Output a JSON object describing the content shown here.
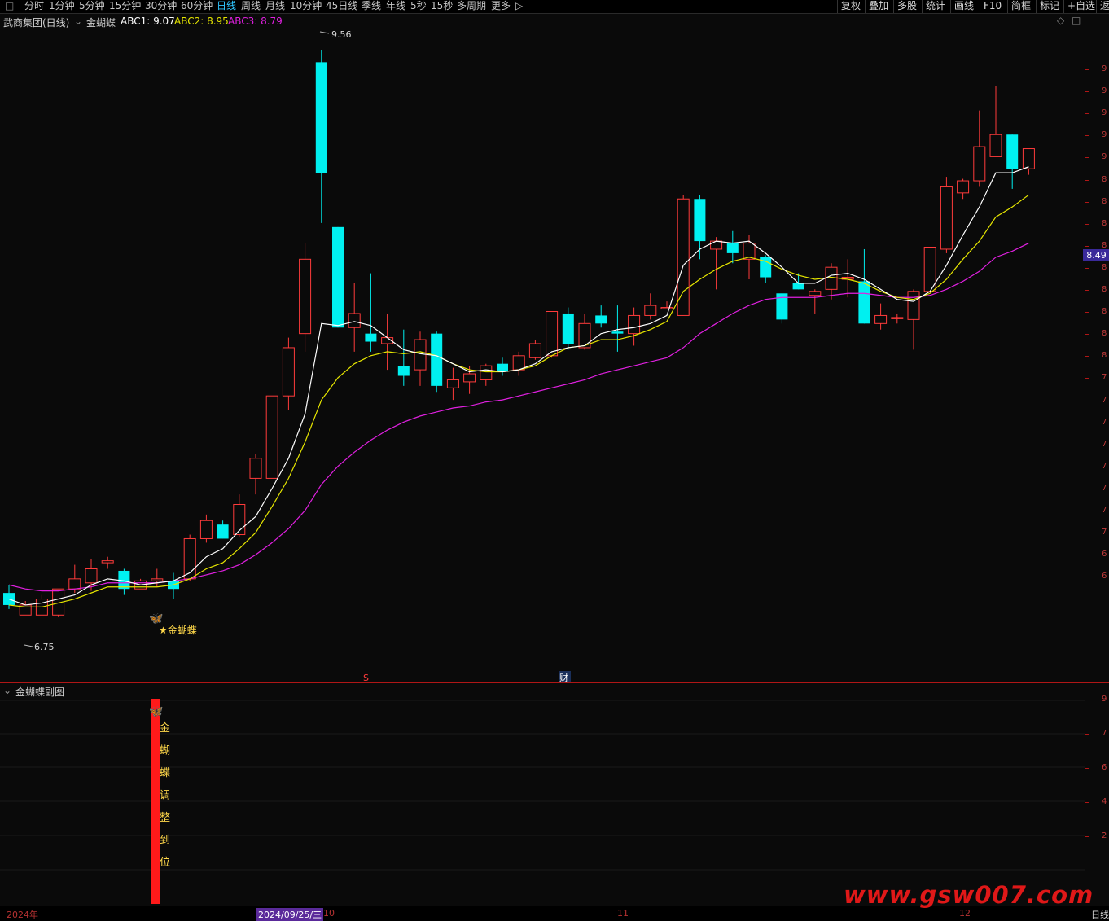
{
  "toolbar": {
    "periods": [
      "分时",
      "1分钟",
      "5分钟",
      "15分钟",
      "30分钟",
      "60分钟",
      "日线",
      "周线",
      "月线",
      "10分钟",
      "45日线",
      "季线",
      "年线",
      "5秒",
      "15秒",
      "多周期",
      "更多"
    ],
    "active_period": "日线",
    "more_arrow": "▷",
    "right_buttons": [
      "复权",
      "叠加",
      "多股",
      "统计",
      "画线",
      "F10",
      "简框",
      "标记",
      "+自选",
      "返"
    ]
  },
  "main_chart": {
    "title": "武商集团(日线)",
    "indicator_name": "金蝴蝶",
    "abc1_label": "ABC1: 9.07",
    "abc2_label": "ABC2: 8.95",
    "abc3_label": "ABC3: 8.79",
    "max_label": "9.56",
    "min_label": "6.75",
    "signal_label": "★金蝴蝶",
    "marker_s": "S",
    "marker_cai": "财",
    "price_tag": "8.49",
    "colors": {
      "up": "#ff3b3b",
      "down": "#00f0f0",
      "abc1": "#ffffff",
      "abc2": "#e6e600",
      "abc3": "#e020e0",
      "grid": "#7a1212"
    }
  },
  "chart_data": {
    "type": "candlestick",
    "ylim": [
      6.5,
      9.7
    ],
    "price_axis_ticks": [
      "9",
      "9",
      "9",
      "9",
      "9",
      "8",
      "8",
      "8",
      "8",
      "8",
      "8",
      "8",
      "8",
      "8",
      "7",
      "7",
      "7",
      "7",
      "7",
      "7",
      "7",
      "7",
      "6",
      "6"
    ],
    "candles": [
      {
        "o": 6.86,
        "c": 6.8,
        "h": 6.9,
        "l": 6.78
      },
      {
        "o": 6.75,
        "c": 6.8,
        "h": 6.82,
        "l": 6.75
      },
      {
        "o": 6.75,
        "c": 6.83,
        "h": 6.85,
        "l": 6.75
      },
      {
        "o": 6.75,
        "c": 6.88,
        "h": 6.88,
        "l": 6.74
      },
      {
        "o": 6.88,
        "c": 6.93,
        "h": 7.0,
        "l": 6.86
      },
      {
        "o": 6.91,
        "c": 6.98,
        "h": 7.03,
        "l": 6.87
      },
      {
        "o": 7.01,
        "c": 7.02,
        "h": 7.04,
        "l": 6.98
      },
      {
        "o": 6.97,
        "c": 6.88,
        "h": 6.98,
        "l": 6.85
      },
      {
        "o": 6.88,
        "c": 6.92,
        "h": 6.93,
        "l": 6.88
      },
      {
        "o": 6.92,
        "c": 6.93,
        "h": 6.98,
        "l": 6.89
      },
      {
        "o": 6.92,
        "c": 6.88,
        "h": 6.96,
        "l": 6.83
      },
      {
        "o": 6.93,
        "c": 7.13,
        "h": 7.15,
        "l": 6.92
      },
      {
        "o": 7.13,
        "c": 7.22,
        "h": 7.25,
        "l": 7.11
      },
      {
        "o": 7.2,
        "c": 7.13,
        "h": 7.22,
        "l": 7.13
      },
      {
        "o": 7.15,
        "c": 7.3,
        "h": 7.35,
        "l": 7.14
      },
      {
        "o": 7.43,
        "c": 7.53,
        "h": 7.55,
        "l": 7.35
      },
      {
        "o": 7.43,
        "c": 7.84,
        "h": 7.84,
        "l": 7.43
      },
      {
        "o": 7.84,
        "c": 8.08,
        "h": 8.13,
        "l": 7.77
      },
      {
        "o": 8.15,
        "c": 8.52,
        "h": 8.6,
        "l": 8.06
      },
      {
        "o": 9.5,
        "c": 8.95,
        "h": 9.56,
        "l": 8.7
      },
      {
        "o": 8.68,
        "c": 8.18,
        "h": 8.68,
        "l": 8.18
      },
      {
        "o": 8.18,
        "c": 8.25,
        "h": 8.4,
        "l": 8.06
      },
      {
        "o": 8.15,
        "c": 8.11,
        "h": 8.45,
        "l": 8.06
      },
      {
        "o": 8.1,
        "c": 8.13,
        "h": 8.25,
        "l": 7.97
      },
      {
        "o": 7.99,
        "c": 7.94,
        "h": 8.17,
        "l": 7.89
      },
      {
        "o": 7.97,
        "c": 8.12,
        "h": 8.16,
        "l": 7.89
      },
      {
        "o": 8.15,
        "c": 7.89,
        "h": 8.16,
        "l": 7.86
      },
      {
        "o": 7.88,
        "c": 7.92,
        "h": 7.98,
        "l": 7.82
      },
      {
        "o": 7.91,
        "c": 7.95,
        "h": 7.99,
        "l": 7.85
      },
      {
        "o": 7.92,
        "c": 7.99,
        "h": 8.0,
        "l": 7.89
      },
      {
        "o": 8.0,
        "c": 7.96,
        "h": 8.03,
        "l": 7.94
      },
      {
        "o": 7.97,
        "c": 8.04,
        "h": 8.06,
        "l": 7.94
      },
      {
        "o": 8.03,
        "c": 8.1,
        "h": 8.12,
        "l": 8.02
      },
      {
        "o": 8.04,
        "c": 8.26,
        "h": 8.26,
        "l": 8.03
      },
      {
        "o": 8.25,
        "c": 8.1,
        "h": 8.28,
        "l": 8.07
      },
      {
        "o": 8.08,
        "c": 8.2,
        "h": 8.25,
        "l": 8.07
      },
      {
        "o": 8.24,
        "c": 8.2,
        "h": 8.29,
        "l": 8.18
      },
      {
        "o": 8.16,
        "c": 8.15,
        "h": 8.29,
        "l": 8.06
      },
      {
        "o": 8.15,
        "c": 8.24,
        "h": 8.28,
        "l": 8.09
      },
      {
        "o": 8.24,
        "c": 8.29,
        "h": 8.35,
        "l": 8.22
      },
      {
        "o": 8.28,
        "c": 8.28,
        "h": 8.31,
        "l": 8.27
      },
      {
        "o": 8.24,
        "c": 8.82,
        "h": 8.84,
        "l": 8.24
      },
      {
        "o": 8.82,
        "c": 8.61,
        "h": 8.84,
        "l": 8.52
      },
      {
        "o": 8.57,
        "c": 8.61,
        "h": 8.63,
        "l": 8.37
      },
      {
        "o": 8.6,
        "c": 8.55,
        "h": 8.66,
        "l": 8.5
      },
      {
        "o": 8.52,
        "c": 8.6,
        "h": 8.64,
        "l": 8.42
      },
      {
        "o": 8.53,
        "c": 8.43,
        "h": 8.54,
        "l": 8.4
      },
      {
        "o": 8.35,
        "c": 8.22,
        "h": 8.35,
        "l": 8.2
      },
      {
        "o": 8.4,
        "c": 8.37,
        "h": 8.45,
        "l": 8.37
      },
      {
        "o": 8.34,
        "c": 8.36,
        "h": 8.37,
        "l": 8.25
      },
      {
        "o": 8.37,
        "c": 8.48,
        "h": 8.5,
        "l": 8.32
      },
      {
        "o": 8.42,
        "c": 8.43,
        "h": 8.52,
        "l": 8.33
      },
      {
        "o": 8.41,
        "c": 8.2,
        "h": 8.57,
        "l": 8.2
      },
      {
        "o": 8.2,
        "c": 8.24,
        "h": 8.3,
        "l": 8.17
      },
      {
        "o": 8.23,
        "c": 8.23,
        "h": 8.25,
        "l": 8.2
      },
      {
        "o": 8.22,
        "c": 8.36,
        "h": 8.37,
        "l": 8.07
      },
      {
        "o": 8.36,
        "c": 8.58,
        "h": 8.58,
        "l": 8.35
      },
      {
        "o": 8.57,
        "c": 8.88,
        "h": 8.93,
        "l": 8.55
      },
      {
        "o": 8.85,
        "c": 8.91,
        "h": 8.92,
        "l": 8.82
      },
      {
        "o": 8.91,
        "c": 9.08,
        "h": 9.26,
        "l": 8.88
      },
      {
        "o": 9.03,
        "c": 9.14,
        "h": 9.38,
        "l": 9.03
      },
      {
        "o": 9.14,
        "c": 8.97,
        "h": 9.14,
        "l": 8.87
      },
      {
        "o": 8.97,
        "c": 9.07,
        "h": 9.07,
        "l": 8.94
      }
    ],
    "abc1": [
      6.83,
      6.8,
      6.81,
      6.83,
      6.85,
      6.9,
      6.93,
      6.92,
      6.9,
      6.91,
      6.92,
      6.96,
      7.04,
      7.08,
      7.17,
      7.24,
      7.38,
      7.53,
      7.75,
      8.2,
      8.19,
      8.21,
      8.19,
      8.13,
      8.07,
      8.05,
      8.04,
      8.0,
      7.96,
      7.97,
      7.96,
      7.97,
      8.0,
      8.06,
      8.08,
      8.09,
      8.15,
      8.17,
      8.18,
      8.2,
      8.24,
      8.49,
      8.57,
      8.61,
      8.6,
      8.61,
      8.55,
      8.48,
      8.4,
      8.4,
      8.44,
      8.45,
      8.42,
      8.37,
      8.32,
      8.31,
      8.36,
      8.49,
      8.64,
      8.78,
      8.95,
      8.95,
      8.98
    ],
    "abc2": [
      6.8,
      6.79,
      6.79,
      6.81,
      6.83,
      6.86,
      6.89,
      6.89,
      6.89,
      6.89,
      6.9,
      6.93,
      6.98,
      7.01,
      7.08,
      7.16,
      7.29,
      7.43,
      7.61,
      7.82,
      7.93,
      8.0,
      8.04,
      8.06,
      8.05,
      8.06,
      8.04,
      8.0,
      7.97,
      7.96,
      7.96,
      7.97,
      7.99,
      8.04,
      8.08,
      8.09,
      8.12,
      8.12,
      8.14,
      8.17,
      8.21,
      8.36,
      8.42,
      8.47,
      8.51,
      8.53,
      8.51,
      8.47,
      8.44,
      8.42,
      8.43,
      8.42,
      8.4,
      8.36,
      8.33,
      8.32,
      8.35,
      8.42,
      8.52,
      8.61,
      8.73,
      8.78,
      8.84
    ],
    "abc3": [
      6.9,
      6.88,
      6.87,
      6.87,
      6.88,
      6.89,
      6.91,
      6.91,
      6.91,
      6.91,
      6.92,
      6.93,
      6.95,
      6.97,
      7.0,
      7.05,
      7.11,
      7.18,
      7.27,
      7.4,
      7.49,
      7.56,
      7.62,
      7.67,
      7.71,
      7.74,
      7.76,
      7.78,
      7.79,
      7.81,
      7.82,
      7.84,
      7.86,
      7.88,
      7.9,
      7.92,
      7.95,
      7.97,
      7.99,
      8.01,
      8.03,
      8.08,
      8.15,
      8.2,
      8.25,
      8.29,
      8.32,
      8.33,
      8.33,
      8.33,
      8.34,
      8.35,
      8.35,
      8.34,
      8.33,
      8.33,
      8.34,
      8.37,
      8.41,
      8.46,
      8.53,
      8.56,
      8.6
    ],
    "time_labels": [
      "2024年",
      "2024/09/25/三",
      "10",
      "11",
      "12"
    ]
  },
  "sub_chart": {
    "title": "金蝴蝶副图",
    "bar_text": "金\n蝴\n蝶\n调\n整\n到\n位",
    "axis_ticks": [
      "9",
      "7",
      "6",
      "4",
      "2"
    ]
  },
  "watermark": "www.gsw007.com",
  "corner_label": "日线"
}
